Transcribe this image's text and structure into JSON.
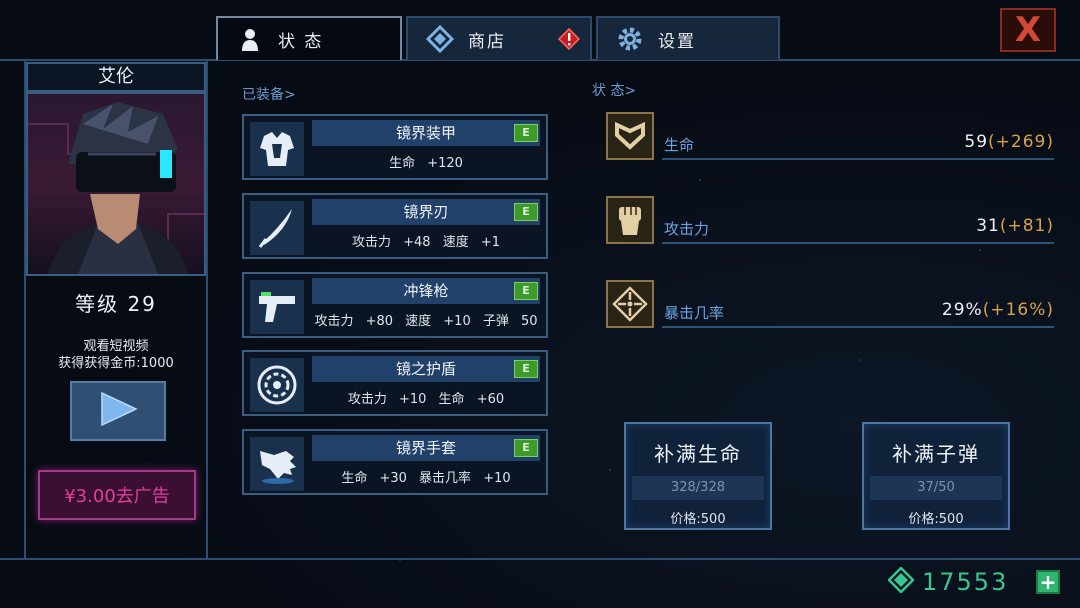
{
  "tabs": [
    {
      "label": "状 态",
      "icon": "person-icon",
      "active": true
    },
    {
      "label": "商店",
      "icon": "diamond-icon",
      "alert": true
    },
    {
      "label": "设置",
      "icon": "gear-icon"
    }
  ],
  "close_label": "X",
  "character": {
    "name": "艾伦",
    "level_text": "等级 29",
    "ad_text_line1": "观看短视频",
    "ad_text_line2": "获得获得金币:1000",
    "buy_ad_label": "¥3.00去广告"
  },
  "equipped": {
    "header": "已装备>",
    "items": [
      {
        "name": "镜界装甲",
        "badge": "E",
        "stats": "生命 +120",
        "icon": "armor-icon"
      },
      {
        "name": "镜界刃",
        "badge": "E",
        "stats": "攻击力 +48  速度 +1",
        "icon": "blade-icon"
      },
      {
        "name": "冲锋枪",
        "badge": "E",
        "stats": "攻击力 +80  速度 +10  子弹 50",
        "icon": "gun-icon"
      },
      {
        "name": "镜之护盾",
        "badge": "E",
        "stats": "攻击力 +10  生命 +60",
        "icon": "shield-icon"
      },
      {
        "name": "镜界手套",
        "badge": "E",
        "stats": "生命 +30  暴击几率 +10",
        "icon": "glove-icon"
      }
    ]
  },
  "status": {
    "header": "状 态>",
    "rows": [
      {
        "name": "生命",
        "value": "59",
        "bonus": "(+269)",
        "icon": "heart-icon"
      },
      {
        "name": "攻击力",
        "value": "31",
        "bonus": "(+81)",
        "icon": "fist-icon"
      },
      {
        "name": "暴击几率",
        "value": "29%",
        "bonus": "(+16%)",
        "icon": "crosshair-icon"
      }
    ]
  },
  "refill": [
    {
      "title": "补满生命",
      "count": "328/328",
      "price": "价格:500"
    },
    {
      "title": "补满子弹",
      "count": "37/50",
      "price": "价格:500"
    }
  ],
  "currency": {
    "value": "17553",
    "icon": "gem-icon"
  },
  "colors": {
    "accent_blue": "#2a4d70",
    "currency_green": "#39c58f",
    "bonus_gold": "#d6a24a",
    "ad_pink": "#e03f9c",
    "close_red": "#d24a36"
  }
}
